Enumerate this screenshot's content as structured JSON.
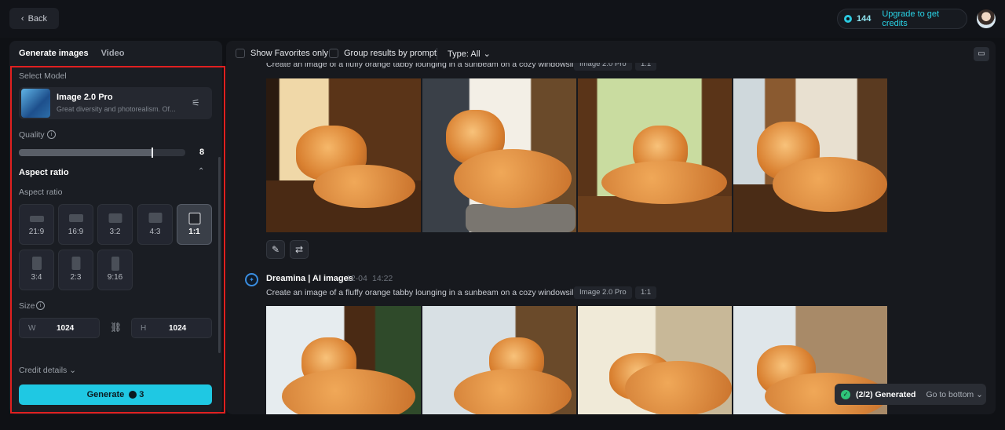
{
  "topbar": {
    "back_label": "Back",
    "credits": "144",
    "upgrade_label": "Upgrade to get credits"
  },
  "left": {
    "tabs": [
      "Generate images",
      "Video"
    ],
    "select_model_label": "Select Model",
    "model_name": "Image 2.0 Pro",
    "model_desc": "Great diversity and photorealism. Of...",
    "quality_label": "Quality",
    "quality_value": "8",
    "quality_fraction": 0.8,
    "aspect_header": "Aspect ratio",
    "aspect_sub": "Aspect ratio",
    "ratios": [
      "21:9",
      "16:9",
      "3:2",
      "4:3",
      "1:1",
      "3:4",
      "2:3",
      "9:16"
    ],
    "selected_ratio": "1:1",
    "size_label": "Size",
    "width_key": "W",
    "width_value": "1024",
    "height_key": "H",
    "height_value": "1024",
    "credit_details": "Credit details",
    "generate_label": "Generate",
    "generate_cost": "3"
  },
  "toolbar": {
    "show_favorites": "Show Favorites only",
    "group_by_prompt": "Group results by prompt",
    "type_filter": "Type: All"
  },
  "group1": {
    "prompt": "Create an image of a fluffy orange tabby lounging in a sunbeam on a cozy windowsill.",
    "model_tag": "Image 2.0 Pro",
    "ratio_tag": "1:1"
  },
  "group2": {
    "author": "Dreamina | AI images",
    "date": "12-04",
    "time": "14:22",
    "prompt": "Create an image of a fluffy orange tabby lounging in a sunbeam on a cozy windowsill.\"",
    "model_tag": "Image 2.0 Pro",
    "ratio_tag": "1:1"
  },
  "toast": {
    "status": "(2/2) Generated",
    "goto": "Go to bottom"
  },
  "colors": {
    "accent": "#1fc8e3",
    "highlight": "#e02020",
    "success": "#2fc47a"
  }
}
